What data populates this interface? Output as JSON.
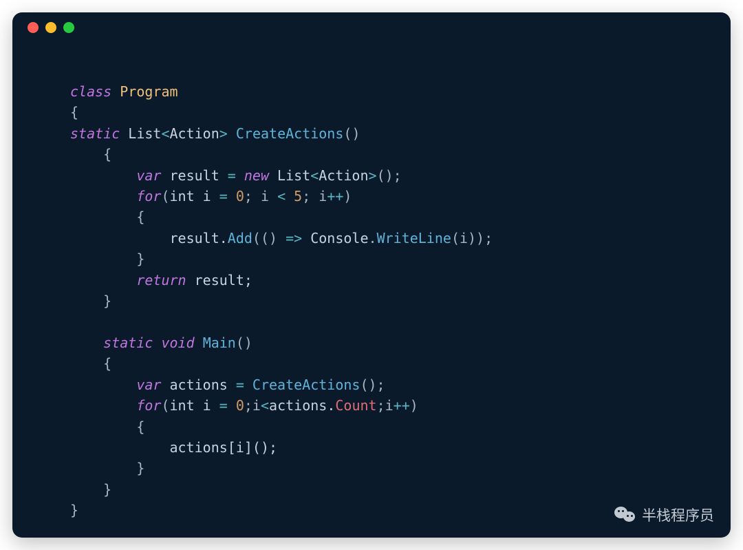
{
  "window": {
    "dots": [
      "red",
      "yellow",
      "green"
    ]
  },
  "code": {
    "tokens": [
      [
        {
          "t": "class",
          "c": "kw"
        },
        {
          "t": " ",
          "c": "punc"
        },
        {
          "t": "Program",
          "c": "classname"
        }
      ],
      [
        {
          "t": "{",
          "c": "punc"
        }
      ],
      [
        {
          "t": "static",
          "c": "kw"
        },
        {
          "t": " ",
          "c": "punc"
        },
        {
          "t": "List",
          "c": "type"
        },
        {
          "t": "<",
          "c": "op"
        },
        {
          "t": "Action",
          "c": "type"
        },
        {
          "t": ">",
          "c": "op"
        },
        {
          "t": " ",
          "c": "punc"
        },
        {
          "t": "CreateActions",
          "c": "fn"
        },
        {
          "t": "()",
          "c": "punc"
        }
      ],
      [
        {
          "t": "    {",
          "c": "punc"
        }
      ],
      [
        {
          "t": "        ",
          "c": "punc"
        },
        {
          "t": "var",
          "c": "kw"
        },
        {
          "t": " result ",
          "c": "ident"
        },
        {
          "t": "=",
          "c": "op"
        },
        {
          "t": " ",
          "c": "punc"
        },
        {
          "t": "new",
          "c": "kw"
        },
        {
          "t": " ",
          "c": "punc"
        },
        {
          "t": "List",
          "c": "type"
        },
        {
          "t": "<",
          "c": "op"
        },
        {
          "t": "Action",
          "c": "type"
        },
        {
          "t": ">",
          "c": "op"
        },
        {
          "t": "();",
          "c": "punc"
        }
      ],
      [
        {
          "t": "        ",
          "c": "punc"
        },
        {
          "t": "for",
          "c": "kw"
        },
        {
          "t": "(",
          "c": "punc"
        },
        {
          "t": "int",
          "c": "type"
        },
        {
          "t": " i ",
          "c": "ident"
        },
        {
          "t": "=",
          "c": "op"
        },
        {
          "t": " ",
          "c": "punc"
        },
        {
          "t": "0",
          "c": "num"
        },
        {
          "t": "; i ",
          "c": "punc"
        },
        {
          "t": "<",
          "c": "op"
        },
        {
          "t": " ",
          "c": "punc"
        },
        {
          "t": "5",
          "c": "num"
        },
        {
          "t": "; i",
          "c": "punc"
        },
        {
          "t": "++",
          "c": "op"
        },
        {
          "t": ")",
          "c": "punc"
        }
      ],
      [
        {
          "t": "        {",
          "c": "punc"
        }
      ],
      [
        {
          "t": "            result.",
          "c": "ident"
        },
        {
          "t": "Add",
          "c": "fn"
        },
        {
          "t": "(() ",
          "c": "punc"
        },
        {
          "t": "=>",
          "c": "op"
        },
        {
          "t": " ",
          "c": "punc"
        },
        {
          "t": "Console",
          "c": "type"
        },
        {
          "t": ".",
          "c": "punc"
        },
        {
          "t": "WriteLine",
          "c": "fn"
        },
        {
          "t": "(i));",
          "c": "punc"
        }
      ],
      [
        {
          "t": "        }",
          "c": "punc"
        }
      ],
      [
        {
          "t": "        ",
          "c": "punc"
        },
        {
          "t": "return",
          "c": "kw"
        },
        {
          "t": " result;",
          "c": "ident"
        }
      ],
      [
        {
          "t": "    }",
          "c": "punc"
        }
      ],
      [
        {
          "t": " ",
          "c": "punc"
        }
      ],
      [
        {
          "t": "    ",
          "c": "punc"
        },
        {
          "t": "static",
          "c": "kw"
        },
        {
          "t": " ",
          "c": "punc"
        },
        {
          "t": "void",
          "c": "kw"
        },
        {
          "t": " ",
          "c": "punc"
        },
        {
          "t": "Main",
          "c": "fn"
        },
        {
          "t": "()",
          "c": "punc"
        }
      ],
      [
        {
          "t": "    {",
          "c": "punc"
        }
      ],
      [
        {
          "t": "        ",
          "c": "punc"
        },
        {
          "t": "var",
          "c": "kw"
        },
        {
          "t": " actions ",
          "c": "ident"
        },
        {
          "t": "=",
          "c": "op"
        },
        {
          "t": " ",
          "c": "punc"
        },
        {
          "t": "CreateActions",
          "c": "fn"
        },
        {
          "t": "();",
          "c": "punc"
        }
      ],
      [
        {
          "t": "        ",
          "c": "punc"
        },
        {
          "t": "for",
          "c": "kw"
        },
        {
          "t": "(",
          "c": "punc"
        },
        {
          "t": "int",
          "c": "type"
        },
        {
          "t": " i ",
          "c": "ident"
        },
        {
          "t": "=",
          "c": "op"
        },
        {
          "t": " ",
          "c": "punc"
        },
        {
          "t": "0",
          "c": "num"
        },
        {
          "t": ";i",
          "c": "punc"
        },
        {
          "t": "<",
          "c": "op"
        },
        {
          "t": "actions.",
          "c": "ident"
        },
        {
          "t": "Count",
          "c": "prop"
        },
        {
          "t": ";i",
          "c": "punc"
        },
        {
          "t": "++",
          "c": "op"
        },
        {
          "t": ")",
          "c": "punc"
        }
      ],
      [
        {
          "t": "        {",
          "c": "punc"
        }
      ],
      [
        {
          "t": "            actions[i]();",
          "c": "ident"
        }
      ],
      [
        {
          "t": "        }",
          "c": "punc"
        }
      ],
      [
        {
          "t": "    }",
          "c": "punc"
        }
      ],
      [
        {
          "t": "}",
          "c": "punc"
        }
      ]
    ]
  },
  "watermark": {
    "text": "半栈程序员",
    "icon": "wechat-icon"
  }
}
